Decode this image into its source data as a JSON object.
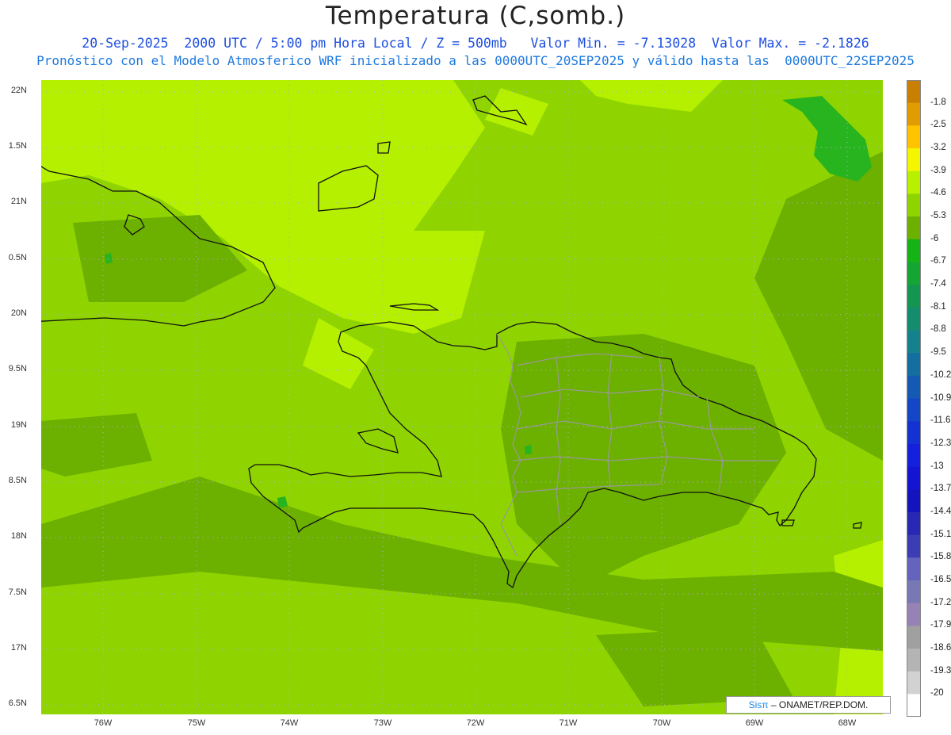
{
  "title": "Temperatura (C,somb.)",
  "subtitle1": "20-Sep-2025  2000 UTC / 5:00 pm Hora Local / Z = 500mb   Valor Min. = -7.13028  Valor Max. = -2.1826",
  "subtitle2": "Pronóstico con el Modelo Atmosferico WRF inicializado a las 0000UTC_20SEP2025 y válido hasta las  0000UTC_22SEP2025",
  "lat_labels": [
    "22N",
    "1.5N",
    "21N",
    "0.5N",
    "20N",
    "9.5N",
    "19N",
    "8.5N",
    "18N",
    "7.5N",
    "17N",
    "6.5N"
  ],
  "lon_labels": [
    "76W",
    "75W",
    "74W",
    "73W",
    "72W",
    "71W",
    "70W",
    "69W",
    "68W"
  ],
  "colorbar": {
    "labels": [
      "-1.8",
      "-2.5",
      "-3.2",
      "-3.9",
      "-4.6",
      "-5.3",
      "-6",
      "-6.7",
      "-7.4",
      "-8.1",
      "-8.8",
      "-9.5",
      "-10.2",
      "-10.9",
      "-11.6",
      "-12.3",
      "-13",
      "-13.7",
      "-14.4",
      "-15.1",
      "-15.8",
      "-16.5",
      "-17.2",
      "-17.9",
      "-18.6",
      "-19.3",
      "-20"
    ],
    "colors": [
      "#c98000",
      "#e09c00",
      "#ffc300",
      "#f5f500",
      "#b9f000",
      "#8fd400",
      "#6cb000",
      "#14b414",
      "#14a532",
      "#149650",
      "#148c6e",
      "#14828c",
      "#146ea0",
      "#145ab4",
      "#1446c8",
      "#1432d2",
      "#1420dc",
      "#1414d2",
      "#1414be",
      "#2828b4",
      "#3c3cb4",
      "#6464be",
      "#7878b4",
      "#9682b4",
      "#a0a0a0",
      "#b4b4b4",
      "#d2d2d2",
      "#ffffff"
    ]
  },
  "field_colors": {
    "base": "#8fd400",
    "warm": "#b4f000",
    "cool": "#6cb000",
    "cold": "#28b41e"
  },
  "credit": {
    "brand": "Sisπ",
    "text": "– ONAMET/REP.DOM."
  }
}
